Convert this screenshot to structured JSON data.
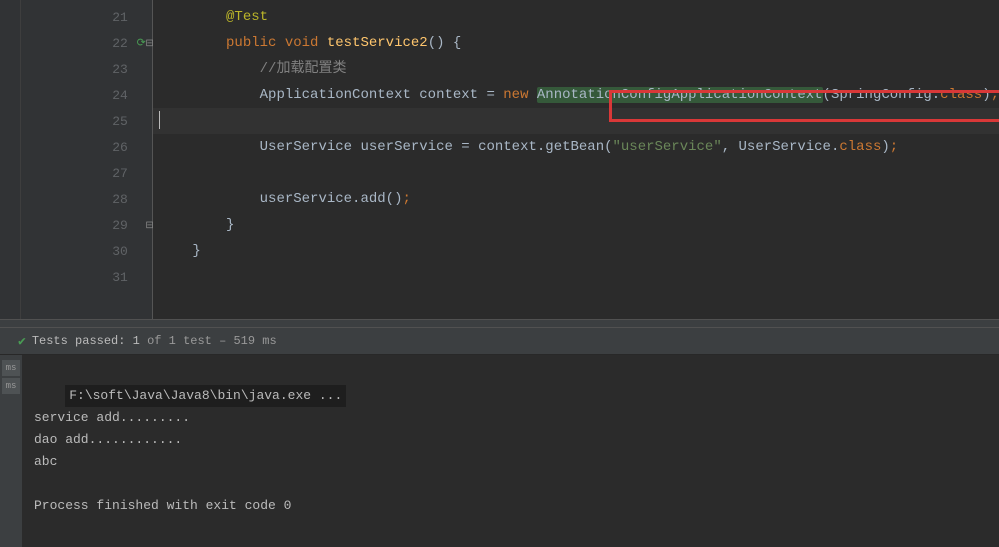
{
  "editor": {
    "lines": [
      {
        "n": 21,
        "indent": "        ",
        "tokens": [
          {
            "t": "@Test",
            "c": "anno"
          }
        ]
      },
      {
        "n": 22,
        "indent": "        ",
        "run": true,
        "fold": "-",
        "tokens": [
          {
            "t": "public ",
            "c": "kw"
          },
          {
            "t": "void ",
            "c": "kw"
          },
          {
            "t": "testService2",
            "c": "method"
          },
          {
            "t": "() {",
            "c": "paren"
          }
        ]
      },
      {
        "n": 23,
        "indent": "            ",
        "tokens": [
          {
            "t": "//加载配置类",
            "c": "comment"
          }
        ]
      },
      {
        "n": 24,
        "indent": "            ",
        "tokens": [
          {
            "t": "ApplicationContext context = ",
            "c": ""
          },
          {
            "t": "new ",
            "c": "kw"
          },
          {
            "t": "AnnotationConfigApplicationContext",
            "c": "",
            "hl": true
          },
          {
            "t": "(SpringConfig.",
            "c": ""
          },
          {
            "t": "class",
            "c": "kw"
          },
          {
            "t": ")",
            "c": ""
          },
          {
            "t": ";",
            "c": "kw"
          }
        ]
      },
      {
        "n": 25,
        "indent": "",
        "caret": true,
        "tokens": []
      },
      {
        "n": 26,
        "indent": "            ",
        "tokens": [
          {
            "t": "UserService userService = context.getBean(",
            "c": ""
          },
          {
            "t": "\"userService\"",
            "c": "string"
          },
          {
            "t": ", ",
            "c": ""
          },
          {
            "t": "UserService.",
            "c": ""
          },
          {
            "t": "class",
            "c": "kw"
          },
          {
            "t": ")",
            "c": ""
          },
          {
            "t": ";",
            "c": "kw"
          }
        ]
      },
      {
        "n": 27,
        "indent": "",
        "tokens": []
      },
      {
        "n": 28,
        "indent": "            ",
        "tokens": [
          {
            "t": "userService.add()",
            "c": ""
          },
          {
            "t": ";",
            "c": "kw"
          }
        ]
      },
      {
        "n": 29,
        "indent": "        ",
        "fold": "-",
        "tokens": [
          {
            "t": "}",
            "c": ""
          }
        ]
      },
      {
        "n": 30,
        "indent": "    ",
        "tokens": [
          {
            "t": "}",
            "c": ""
          }
        ]
      },
      {
        "n": 31,
        "indent": "",
        "tokens": []
      }
    ]
  },
  "status": {
    "passed_label": "Tests passed:",
    "passed_count": "1",
    "of_label": "of 1 test",
    "time": "– 519 ms"
  },
  "console": {
    "exe": "F:\\soft\\Java\\Java8\\bin\\java.exe ...",
    "out1": "service add.........",
    "out2": "dao add............",
    "out3": "abc",
    "blank": "",
    "exit": "Process finished with exit code 0"
  },
  "tabs": {
    "t1": "ms",
    "t2": "ms"
  }
}
